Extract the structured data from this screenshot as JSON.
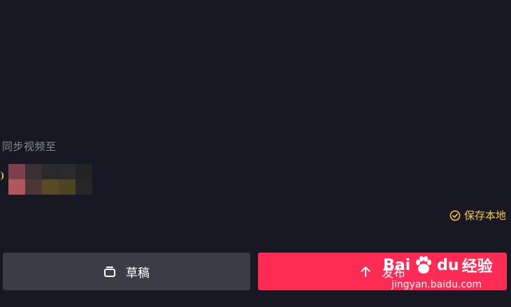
{
  "sync": {
    "label": "同步视频至"
  },
  "save_local": {
    "label": "保存本地",
    "icon": "check-circle-icon",
    "color": "#f3c93f"
  },
  "buttons": {
    "draft_label": "草稿",
    "draft_icon": "draft-box-icon",
    "publish_label": "发布",
    "publish_icon": "upload-arrow-icon",
    "publish_color": "#fe2c55",
    "draft_color": "#3c3c48"
  },
  "watermark": {
    "brand_text": "Bai",
    "brand_text_2": "du",
    "brand_suffix": "经验",
    "url": "jingyan.baidu.com"
  }
}
